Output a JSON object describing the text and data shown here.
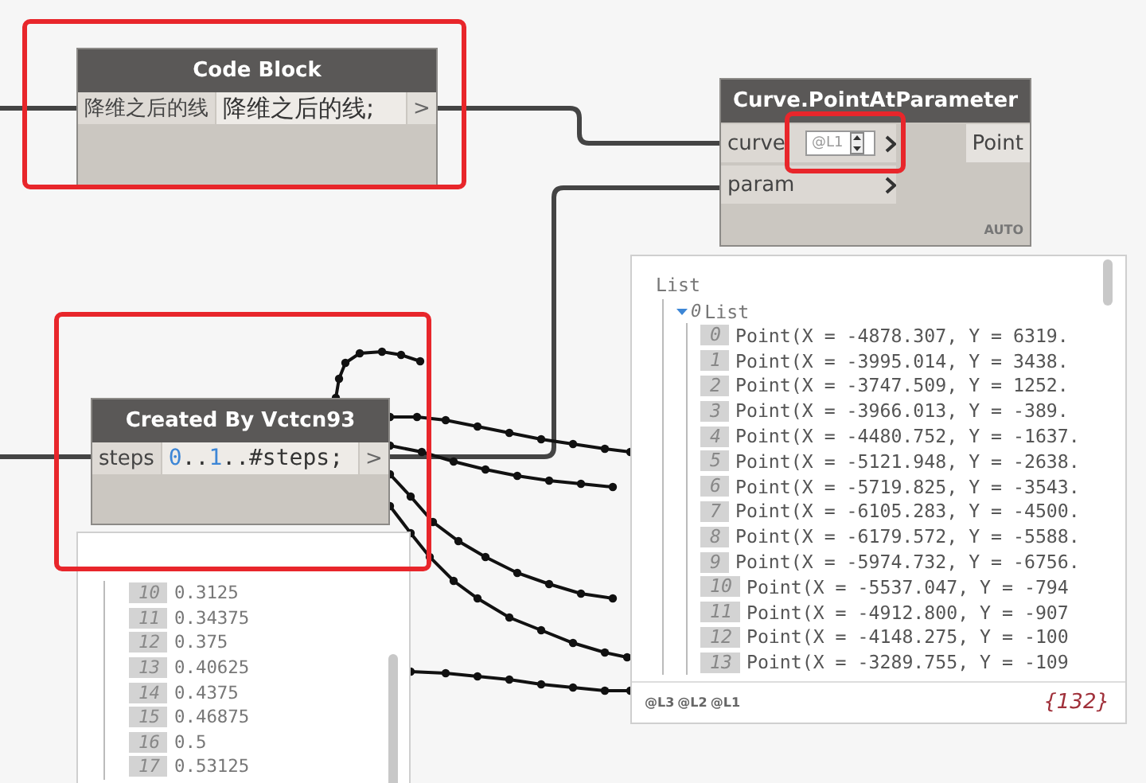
{
  "code_block": {
    "title": "Code Block",
    "input": "降维之后的线",
    "code": [
      {
        "kind": "plain",
        "text": "降维之后的线;"
      }
    ],
    "output": ">",
    "highlighted": true
  },
  "point_node": {
    "title": "Curve.PointAtParameter",
    "inputs": [
      {
        "label": "curve",
        "level_field": {
          "value": "@L1",
          "highlighted": true
        }
      },
      {
        "label": "param"
      }
    ],
    "output": "Point",
    "lacing": "AUTO"
  },
  "created_node": {
    "title": "Created By Vctcn93",
    "input": "steps",
    "code": [
      {
        "kind": "number",
        "text": "0"
      },
      {
        "kind": "plain",
        "text": ".."
      },
      {
        "kind": "number",
        "text": "1"
      },
      {
        "kind": "plain",
        "text": "..#steps;"
      }
    ],
    "output": ">",
    "highlighted": true
  },
  "list_preview": {
    "title": "List",
    "sublist": {
      "index": "0",
      "label": "List",
      "expanded": true,
      "items": [
        {
          "index": "0",
          "text": "Point(X = -4878.307, Y = 6319."
        },
        {
          "index": "1",
          "text": "Point(X = -3995.014, Y = 3438."
        },
        {
          "index": "2",
          "text": "Point(X = -3747.509, Y = 1252."
        },
        {
          "index": "3",
          "text": "Point(X = -3966.013, Y = -389."
        },
        {
          "index": "4",
          "text": "Point(X = -4480.752, Y = -1637."
        },
        {
          "index": "5",
          "text": "Point(X = -5121.948, Y = -2638."
        },
        {
          "index": "6",
          "text": "Point(X = -5719.825, Y = -3543."
        },
        {
          "index": "7",
          "text": "Point(X = -6105.283, Y = -4500."
        },
        {
          "index": "8",
          "text": "Point(X = -6179.572, Y = -5588."
        },
        {
          "index": "9",
          "text": "Point(X = -5974.732, Y = -6756."
        },
        {
          "index": "10",
          "text": "Point(X = -5537.047, Y = -794"
        },
        {
          "index": "11",
          "text": "Point(X = -4912.800, Y = -907"
        },
        {
          "index": "12",
          "text": "Point(X = -4148.275, Y = -100"
        },
        {
          "index": "13",
          "text": "Point(X = -3289.755, Y = -109"
        }
      ]
    },
    "levels": [
      "@L3",
      "@L2",
      "@L1"
    ],
    "count": "{132}"
  },
  "number_preview": {
    "items": [
      {
        "index": "10",
        "value": "0.3125"
      },
      {
        "index": "11",
        "value": "0.34375"
      },
      {
        "index": "12",
        "value": "0.375"
      },
      {
        "index": "13",
        "value": "0.40625"
      },
      {
        "index": "14",
        "value": "0.4375"
      },
      {
        "index": "15",
        "value": "0.46875"
      },
      {
        "index": "16",
        "value": "0.5"
      },
      {
        "index": "17",
        "value": "0.53125"
      }
    ]
  }
}
